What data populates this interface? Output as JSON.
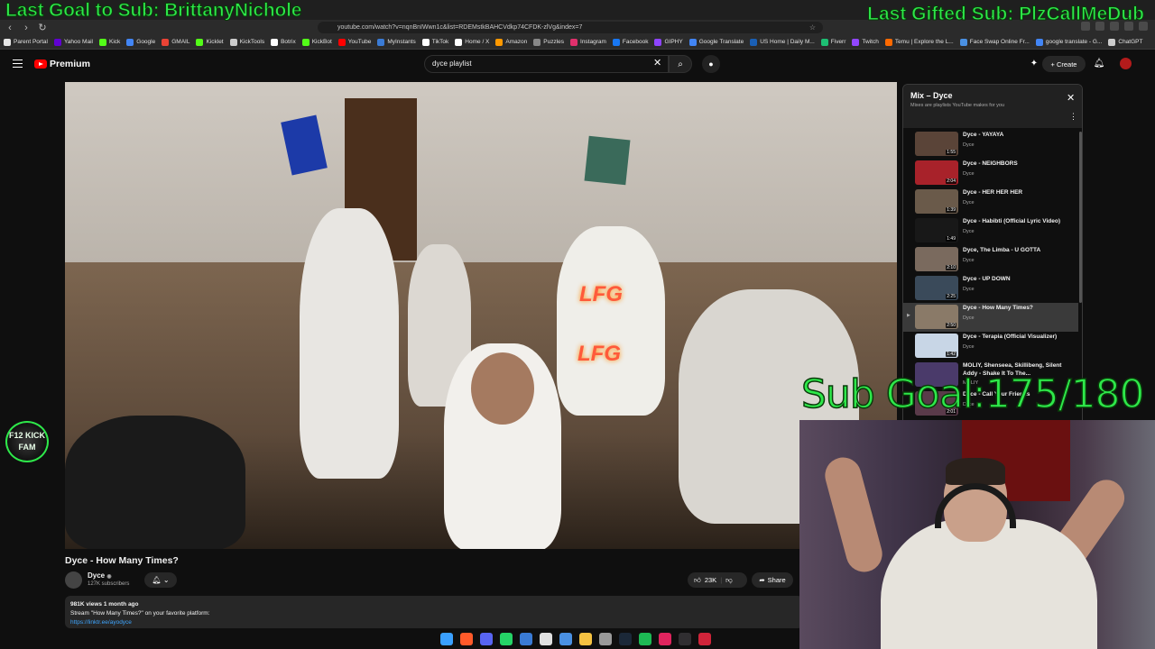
{
  "overlay": {
    "last_goal": "Last Goal to Sub: BrittanyNichole",
    "last_gifted": "Last Gifted Sub: PlzCallMeDub",
    "sub_goal": "Sub Goal:175/180",
    "badge": "F12 KICK FAM"
  },
  "browser": {
    "url": "youtube.com/watch?v=nqnBnIWwn1c&list=RDEMstkBAHCVdkp74CFDK-zlVg&index=7",
    "bookmarks": [
      {
        "label": "Parent Portal",
        "color": "#e6e6e6"
      },
      {
        "label": "Yahoo Mail",
        "color": "#6001d2"
      },
      {
        "label": "Kick",
        "color": "#53fc18"
      },
      {
        "label": "Google",
        "color": "#4285f4"
      },
      {
        "label": "GMAIL",
        "color": "#ea4335"
      },
      {
        "label": "Kicklet",
        "color": "#53fc18"
      },
      {
        "label": "KickTools",
        "color": "#cccccc"
      },
      {
        "label": "Botrix",
        "color": "#ffffff"
      },
      {
        "label": "KickBot",
        "color": "#53fc18"
      },
      {
        "label": "YouTube",
        "color": "#ff0000"
      },
      {
        "label": "MyInstants",
        "color": "#3a7bd5"
      },
      {
        "label": "TikTok",
        "color": "#ffffff"
      },
      {
        "label": "Home / X",
        "color": "#ffffff"
      },
      {
        "label": "Amazon",
        "color": "#ff9900"
      },
      {
        "label": "Puzzles",
        "color": "#888888"
      },
      {
        "label": "Instagram",
        "color": "#e1306c"
      },
      {
        "label": "Facebook",
        "color": "#1877f2"
      },
      {
        "label": "GIPHY",
        "color": "#8e44ff"
      },
      {
        "label": "Google Translate",
        "color": "#4285f4"
      },
      {
        "label": "US Home | Daily M...",
        "color": "#1a5fb4"
      },
      {
        "label": "Fiverr",
        "color": "#1dbf73"
      },
      {
        "label": "Twitch",
        "color": "#9146ff"
      },
      {
        "label": "Temu | Explore the L...",
        "color": "#ff6a00"
      },
      {
        "label": "Face Swap Online Fr...",
        "color": "#4a90e2"
      },
      {
        "label": "google translate - G...",
        "color": "#4285f4"
      },
      {
        "label": "ChatGPT",
        "color": "#cccccc"
      }
    ]
  },
  "youtube": {
    "logo_text": "Premium",
    "search_value": "dyce playlist",
    "create_label": "Create"
  },
  "video": {
    "title": "Dyce - How Many Times?",
    "lfg": "LFG",
    "channel": "Dyce",
    "subscribers": "127K subscribers",
    "likes": "23K",
    "share_label": "Share",
    "views_meta": "981K views  1 month ago",
    "description": "Stream \"How Many Times?\" on your favorite platform:",
    "link": "https://linktr.ee/ayodyce"
  },
  "playlist": {
    "title": "Mix – Dyce",
    "subtitle": "Mixes are playlists YouTube makes for you",
    "items": [
      {
        "title": "Dyce - YAYAYA",
        "channel": "Dyce",
        "duration": "1:55",
        "color": "#5a4438"
      },
      {
        "title": "Dyce - NEIGHBORS",
        "channel": "Dyce",
        "duration": "2:04",
        "color": "#a8222a"
      },
      {
        "title": "Dyce - HER HER HER",
        "channel": "Dyce",
        "duration": "1:39",
        "color": "#6a5a4a"
      },
      {
        "title": "Dyce - Habibti (Official Lyric Video)",
        "channel": "Dyce",
        "duration": "1:49",
        "color": "#181818"
      },
      {
        "title": "Dyce, The Limba - U GOTTA",
        "channel": "Dyce",
        "duration": "2:10",
        "color": "#7a6a5e"
      },
      {
        "title": "Dyce - UP DOWN",
        "channel": "Dyce",
        "duration": "2:25",
        "color": "#3a4a5a"
      },
      {
        "title": "Dyce - How Many Times?",
        "channel": "Dyce",
        "duration": "2:50",
        "color": "#8a7a68"
      },
      {
        "title": "Dyce - Terapia (Official Visualizer)",
        "channel": "Dyce",
        "duration": "1:42",
        "color": "#c8d6e6"
      },
      {
        "title": "MOLIY, Shenseea, Skillibeng, Silent Addy - Shake It To The...",
        "channel": "MOLIY",
        "duration": "",
        "color": "#4a3a6a"
      },
      {
        "title": "Dyce - Call Your Friends",
        "channel": "Dyce",
        "duration": "2:01",
        "color": "#5a3a4a"
      }
    ]
  },
  "taskbar": {
    "icons": [
      {
        "name": "windows-icon",
        "color": "#3aa0ff"
      },
      {
        "name": "brave-icon",
        "color": "#ff5a2a"
      },
      {
        "name": "discord-icon",
        "color": "#5865f2"
      },
      {
        "name": "whatsapp-icon",
        "color": "#25d366"
      },
      {
        "name": "store-icon",
        "color": "#3a7bd5"
      },
      {
        "name": "calendar-icon",
        "color": "#e0e0e0"
      },
      {
        "name": "photos-icon",
        "color": "#4a90e2"
      },
      {
        "name": "folder-icon",
        "color": "#f5c242"
      },
      {
        "name": "settings-icon",
        "color": "#9a9a9a"
      },
      {
        "name": "steam-icon",
        "color": "#1b2838"
      },
      {
        "name": "spotify-icon",
        "color": "#1db954"
      },
      {
        "name": "ruby-icon",
        "color": "#e0245e"
      },
      {
        "name": "obs-icon",
        "color": "#302e31"
      },
      {
        "name": "pin-icon",
        "color": "#d0243a"
      }
    ]
  }
}
